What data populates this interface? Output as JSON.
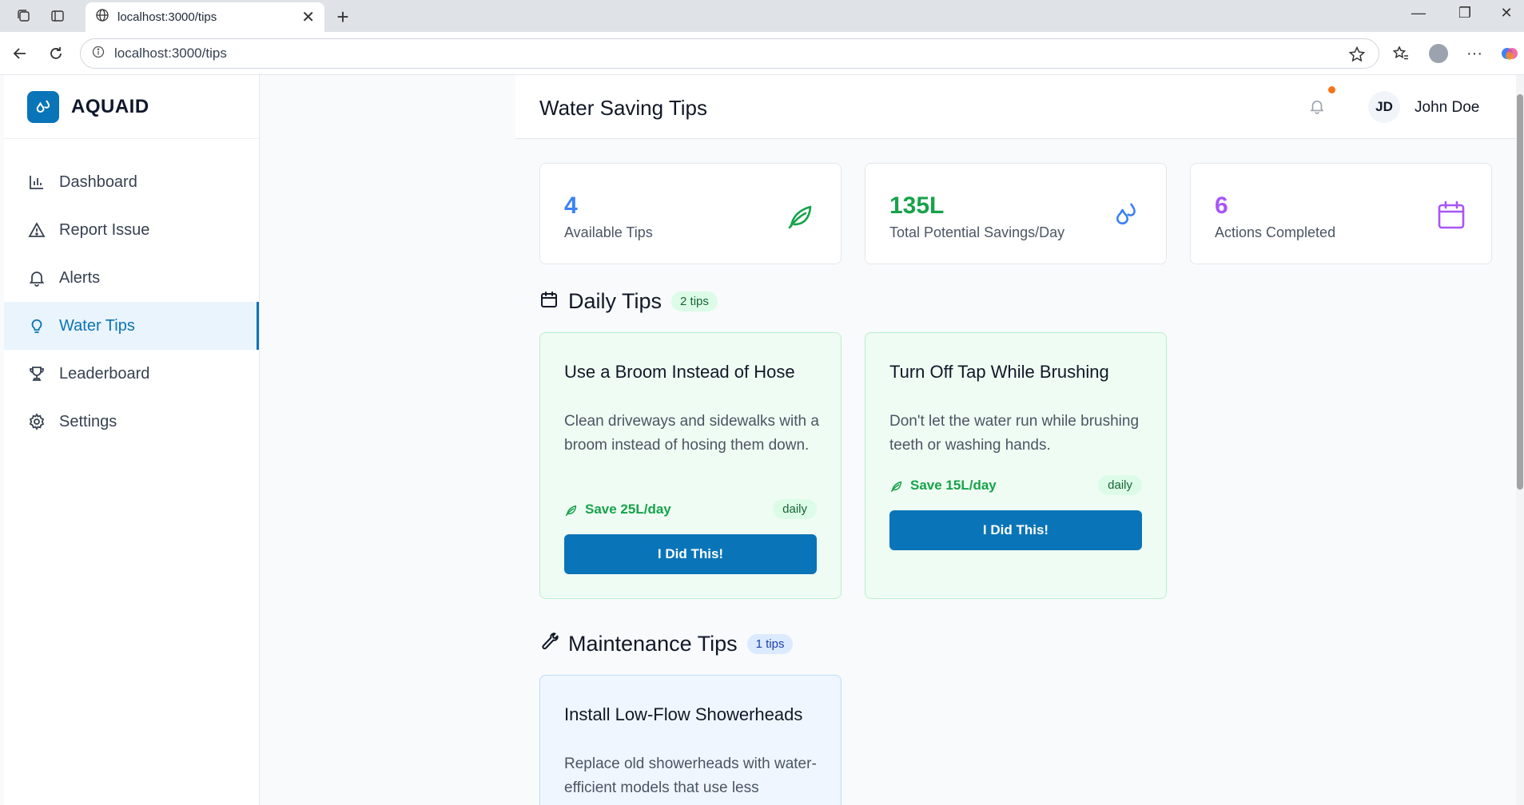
{
  "browser": {
    "tab_title": "localhost:3000/tips",
    "url": "localhost:3000/tips"
  },
  "sidebar": {
    "brand": "AQUAID",
    "items": [
      {
        "label": "Dashboard",
        "icon": "bar-chart-icon",
        "active": false
      },
      {
        "label": "Report Issue",
        "icon": "warning-triangle-icon",
        "active": false
      },
      {
        "label": "Alerts",
        "icon": "bell-icon",
        "active": false
      },
      {
        "label": "Water Tips",
        "icon": "lightbulb-icon",
        "active": true
      },
      {
        "label": "Leaderboard",
        "icon": "trophy-icon",
        "active": false
      },
      {
        "label": "Settings",
        "icon": "gear-icon",
        "active": false
      }
    ]
  },
  "header": {
    "title": "Water Saving Tips",
    "user_initials": "JD",
    "user_name": "John Doe"
  },
  "stats": [
    {
      "value": "4",
      "label": "Available Tips",
      "color": "#3b82f6",
      "icon": "leaf-icon",
      "icon_color": "#16a34a"
    },
    {
      "value": "135L",
      "label": "Total Potential Savings/Day",
      "color": "#16a34a",
      "icon": "droplets-icon",
      "icon_color": "#3b82f6"
    },
    {
      "value": "6",
      "label": "Actions Completed",
      "color": "#a855f7",
      "icon": "calendar-icon",
      "icon_color": "#a855f7"
    }
  ],
  "daily": {
    "title": "Daily Tips",
    "count": "2 tips",
    "tips": [
      {
        "title": "Use a Broom Instead of Hose",
        "description": "Clean driveways and sidewalks with a broom instead of hosing them down.",
        "save": "Save 25L/day",
        "frequency": "daily",
        "button": "I Did This!"
      },
      {
        "title": "Turn Off Tap While Brushing",
        "description": "Don't let the water run while brushing teeth or washing hands.",
        "save": "Save 15L/day",
        "frequency": "daily",
        "button": "I Did This!"
      }
    ]
  },
  "maintenance": {
    "title": "Maintenance Tips",
    "count": "1 tips",
    "tips": [
      {
        "title": "Install Low-Flow Showerheads",
        "description": "Replace old showerheads with water-efficient models that use less"
      }
    ]
  }
}
